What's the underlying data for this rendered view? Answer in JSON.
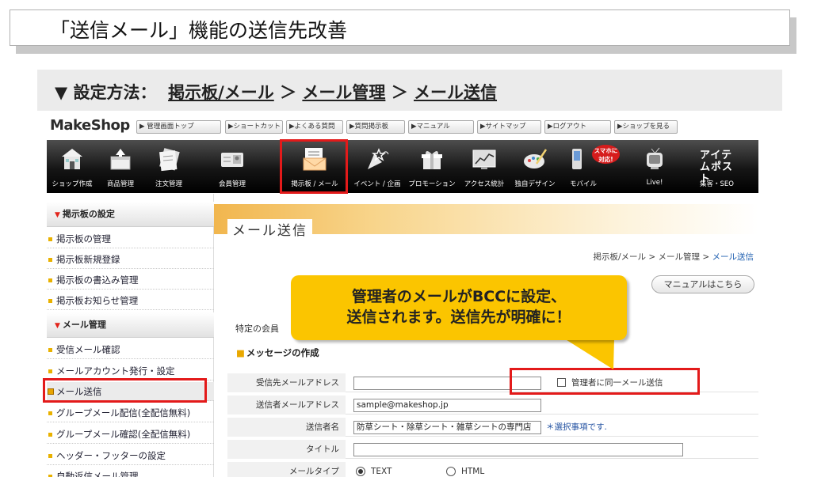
{
  "slide": {
    "title": "「送信メール」機能の送信先改善",
    "method_prefix": "▼ 設定方法：",
    "path1": "掲示板/メール",
    "sep1": "＞",
    "path2": "メール管理",
    "sep2": "＞",
    "path3": "メール送信"
  },
  "admin": {
    "logo": "MakeShop",
    "top_nav": [
      "▶ 管理画面トップ",
      "▶ショートカット",
      "▶よくある質問",
      "▶質問掲示板",
      "▶マニュアル",
      "▶サイトマップ",
      "▶ログアウト",
      "▶ショップを見る"
    ],
    "menu": [
      {
        "label": "ショップ作成",
        "icon": "shop-icon"
      },
      {
        "label": "商品管理",
        "icon": "product-box-icon"
      },
      {
        "label": "注文管理",
        "icon": "order-icon"
      },
      {
        "label": "会員管理",
        "icon": "member-card-icon"
      },
      {
        "label": "掲示板 / メール",
        "icon": "mail-icon"
      },
      {
        "label": "イベント / 企画",
        "icon": "party-popper-icon"
      },
      {
        "label": "プロモーション",
        "icon": "gift-icon"
      },
      {
        "label": "アクセス統計",
        "icon": "chart-icon"
      },
      {
        "label": "独自デザイン",
        "icon": "palette-icon"
      },
      {
        "label": "モバイル",
        "icon": "mobile-icon"
      },
      {
        "label": "Live!",
        "icon": "tv-icon"
      },
      {
        "label": "集客・SEO",
        "icon": "item-post-icon"
      }
    ],
    "mobile_badge": "スマホに対応!",
    "item_post_text": "アイテムポスト"
  },
  "sidebar": {
    "section1": "掲示板の設定",
    "items1": [
      "掲示板の管理",
      "掲示板新規登録",
      "掲示板の書込み管理",
      "掲示板お知らせ管理"
    ],
    "section2": "メール管理",
    "items2": [
      "受信メール確認",
      "メールアカウント発行・設定",
      "メール送信",
      "グループメール配信(全配信無料)",
      "グループメール確認(全配信無料)",
      "ヘッダー・フッターの設定",
      "自動返信メール管理"
    ]
  },
  "content": {
    "banner_title": "メール送信",
    "breadcrumb_prefix": "掲示板/メール > メール管理 > ",
    "breadcrumb_current": "メール送信",
    "manual_button": "マニュアルはこちら",
    "note": "特定の会員",
    "section_title": "メッセージの作成",
    "form": {
      "to_label": "受信先メールアドレス",
      "to_value": "",
      "admin_copy_label": "管理者に同一メール送信",
      "from_label": "送信者メールアドレス",
      "from_value": "sample@makeshop.jp",
      "sender_label": "送信者名",
      "sender_value": "防草シート・除草シート・雑草シートの専門店",
      "sender_note": "＊選択事項です.",
      "title_label": "タイトル",
      "title_value": "",
      "type_label": "メールタイプ",
      "type_text": "TEXT",
      "type_html": "HTML"
    }
  },
  "callout": {
    "line1": "管理者のメールがBCCに設定、",
    "line2": "送信されます。送信先が明確に！"
  },
  "colors": {
    "highlight_red": "#e31a1a",
    "callout_yellow": "#fbc500",
    "menubar_dark": "#151515"
  }
}
